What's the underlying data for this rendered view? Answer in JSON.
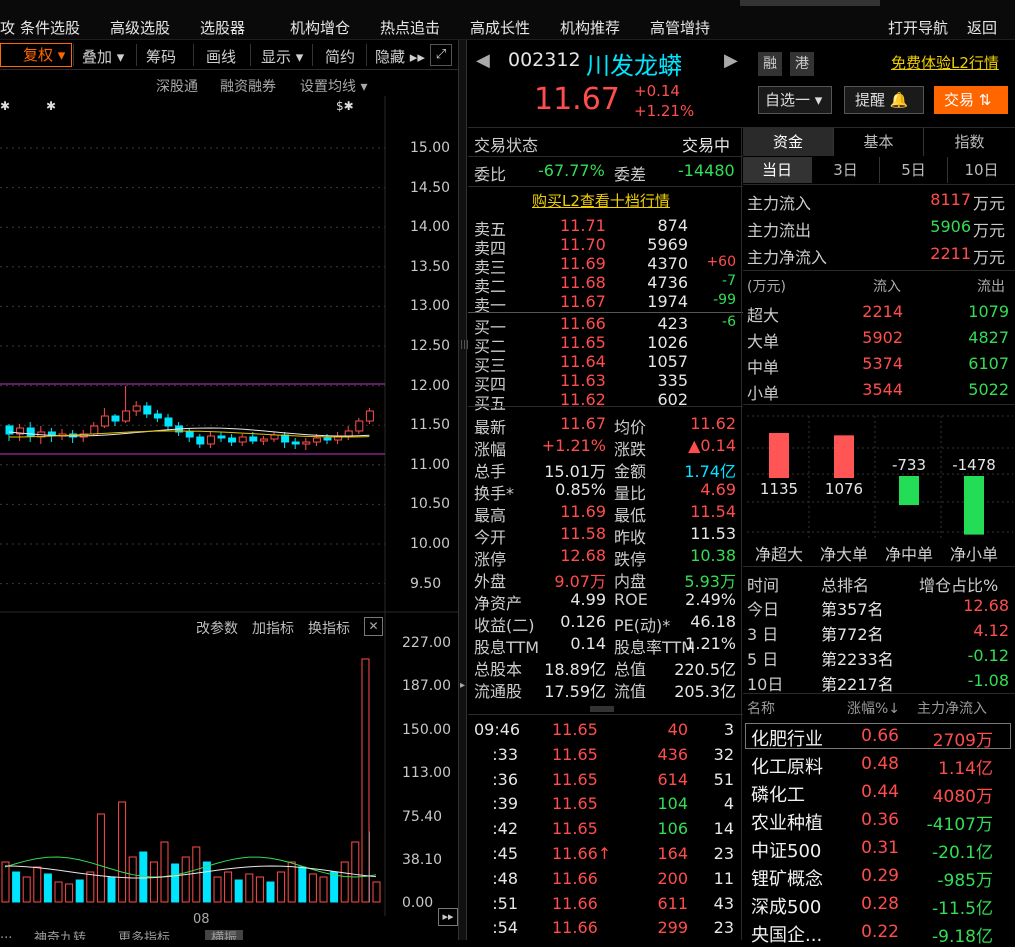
{
  "menu": [
    "攻",
    "条件选股",
    "高级选股",
    "选股器",
    "机构增仓",
    "热点追击",
    "高成长性",
    "机构推荐",
    "高管增持",
    "打开导航",
    "返回"
  ],
  "toolbar": {
    "fuquan": "复权",
    "diejia": "叠加",
    "chouma": "筹码",
    "huaxian": "画线",
    "xianshi": "显示",
    "jianyue": "简约",
    "yincang": "隐藏"
  },
  "sub_toolbar": [
    "深股通",
    "融资融券",
    "设置均线"
  ],
  "price_axis": [
    "15.00",
    "14.50",
    "14.00",
    "13.50",
    "13.00",
    "12.50",
    "12.00",
    "11.50",
    "11.00",
    "10.50",
    "10.00",
    "9.50"
  ],
  "volume_axis": [
    "227.00",
    "187.00",
    "150.00",
    "113.00",
    "75.40",
    "38.10",
    "0.00"
  ],
  "indicator_buttons": [
    "改参数",
    "加指标",
    "换指标"
  ],
  "x_label": "08",
  "bottom_tabs": [
    "...",
    "神奇九转",
    "更多指标",
    "横振"
  ],
  "quote": {
    "code": "002312",
    "name": "川发龙蟒",
    "price": "11.67",
    "change": "+0.14",
    "pct": "+1.21%",
    "badge_rong": "融",
    "badge_gang": "港",
    "l2_link": "免费体验L2行情",
    "zixuan": "自选一",
    "tixing": "提醒",
    "jiaoyi": "交易"
  },
  "status": {
    "label": "交易状态",
    "value": "交易中",
    "webi_label": "委比",
    "webi": "-67.77%",
    "wecha_label": "委差",
    "wecha": "-14480",
    "buy_link": "购买L2查看十档行情"
  },
  "sell": [
    [
      "卖五",
      "11.71",
      "874",
      ""
    ],
    [
      "卖四",
      "11.70",
      "5969",
      ""
    ],
    [
      "卖三",
      "11.69",
      "4370",
      "+60"
    ],
    [
      "卖二",
      "11.68",
      "4736",
      "-7"
    ],
    [
      "卖一",
      "11.67",
      "1974",
      "-99"
    ]
  ],
  "buy": [
    [
      "买一",
      "11.66",
      "423",
      "-6"
    ],
    [
      "买二",
      "11.65",
      "1026",
      ""
    ],
    [
      "买三",
      "11.64",
      "1057",
      ""
    ],
    [
      "买四",
      "11.63",
      "335",
      ""
    ],
    [
      "买五",
      "11.62",
      "602",
      ""
    ]
  ],
  "stats": [
    [
      "最新",
      "11.67",
      "均价",
      "11.62"
    ],
    [
      "涨幅",
      "+1.21%",
      "涨跌",
      "▲0.14"
    ],
    [
      "总手",
      "15.01万",
      "金额",
      "1.74亿"
    ],
    [
      "换手*",
      "0.85%",
      "量比",
      "4.69"
    ],
    [
      "最高",
      "11.69",
      "最低",
      "11.54"
    ],
    [
      "今开",
      "11.58",
      "昨收",
      "11.53"
    ],
    [
      "涨停",
      "12.68",
      "跌停",
      "10.38"
    ],
    [
      "外盘",
      "9.07万",
      "内盘",
      "5.93万"
    ],
    [
      "净资产",
      "4.99",
      "ROE",
      "2.49%"
    ],
    [
      "收益(二)",
      "0.126",
      "PE(动)*",
      "46.18"
    ],
    [
      "股息TTM",
      "0.14",
      "股息率TTM",
      "1.21%"
    ],
    [
      "总股本",
      "18.89亿",
      "总值",
      "220.5亿"
    ],
    [
      "流通股",
      "17.59亿",
      "流值",
      "205.3亿"
    ]
  ],
  "ticks": [
    [
      "09:46",
      "11.65",
      "40",
      "3"
    ],
    [
      ":33",
      "11.65",
      "436",
      "32"
    ],
    [
      ":36",
      "11.65",
      "614",
      "51"
    ],
    [
      ":39",
      "11.65",
      "104",
      "4"
    ],
    [
      ":42",
      "11.65",
      "106",
      "14"
    ],
    [
      ":45",
      "11.66↑",
      "164",
      "23"
    ],
    [
      ":48",
      "11.66",
      "200",
      "11"
    ],
    [
      ":51",
      "11.66",
      "611",
      "43"
    ],
    [
      ":54",
      "11.66",
      "299",
      "23"
    ]
  ],
  "fund_tabs": [
    "资金",
    "基本",
    "指数"
  ],
  "period_tabs": [
    "当日",
    "3日",
    "5日",
    "10日"
  ],
  "main_flow": [
    [
      "主力流入",
      "8117",
      "万元"
    ],
    [
      "主力流出",
      "5906",
      "万元"
    ],
    [
      "主力净流入",
      "2211",
      "万元"
    ]
  ],
  "flow_table": {
    "unit": "(万元)",
    "in": "流入",
    "out": "流出",
    "rows": [
      [
        "超大",
        "2214",
        "1079"
      ],
      [
        "大单",
        "5902",
        "4827"
      ],
      [
        "中单",
        "5374",
        "6107"
      ],
      [
        "小单",
        "3544",
        "5022"
      ]
    ]
  },
  "net_bars": {
    "values": [
      1135,
      1076,
      -733,
      -1478
    ],
    "labels": [
      "1135",
      "1076",
      "-733",
      "-1478"
    ],
    "categories": [
      "净超大",
      "净大单",
      "净中单",
      "净小单"
    ]
  },
  "rank": {
    "headers": [
      "时间",
      "总排名",
      "增仓占比%"
    ],
    "rows": [
      [
        "今日",
        "第357名",
        "12.68"
      ],
      [
        "3 日",
        "第772名",
        "4.12"
      ],
      [
        "5 日",
        "第2233名",
        "-0.12"
      ],
      [
        "10日",
        "第2217名",
        "-1.08"
      ]
    ]
  },
  "sector": {
    "headers": [
      "名称",
      "涨幅%↓",
      "主力净流入"
    ],
    "rows": [
      [
        "化肥行业",
        "0.66",
        "2709万"
      ],
      [
        "化工原料",
        "0.48",
        "1.14亿"
      ],
      [
        "磷化工",
        "0.44",
        "4080万"
      ],
      [
        "农业种植",
        "0.36",
        "-4107万"
      ],
      [
        "中证500",
        "0.31",
        "-20.1亿"
      ],
      [
        "锂矿概念",
        "0.29",
        "-985万"
      ],
      [
        "深成500",
        "0.28",
        "-11.5亿"
      ],
      [
        "央国企...",
        "0.22",
        "-9.18亿"
      ]
    ]
  },
  "colors": {
    "up": "#ff4d4d",
    "down": "#00e5ff",
    "green": "#33dd55",
    "accent": "#ff6600"
  }
}
